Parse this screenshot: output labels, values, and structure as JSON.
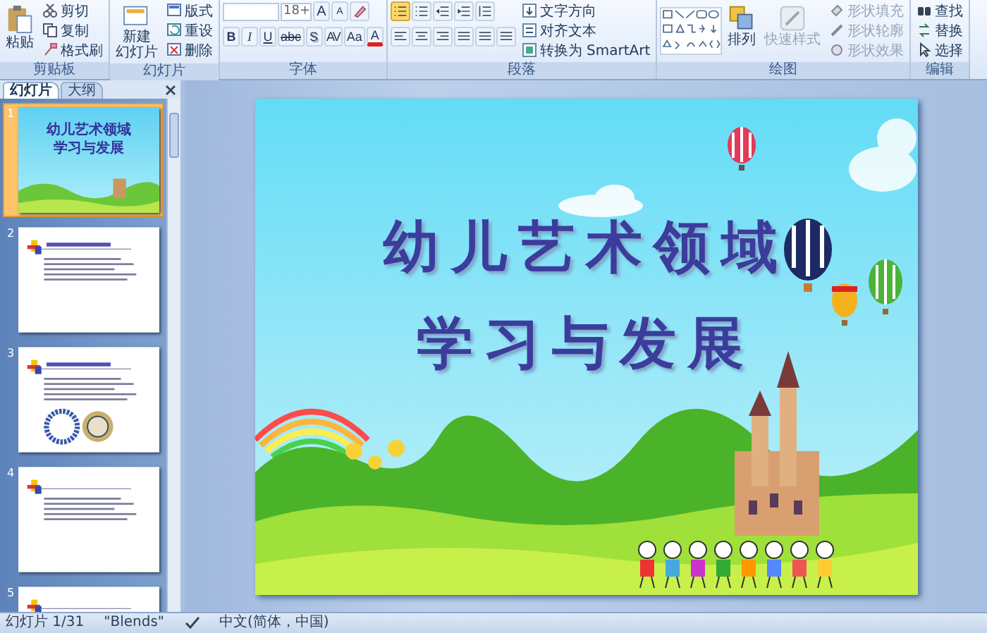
{
  "ribbon": {
    "clipboard": {
      "label": "剪贴板",
      "paste": "粘贴",
      "actions": [
        "剪切",
        "复制",
        "格式刷"
      ]
    },
    "slides": {
      "label": "幻灯片",
      "new_slide": [
        "新建",
        "幻灯片"
      ],
      "actions": [
        "版式",
        "重设",
        "删除"
      ]
    },
    "font": {
      "label": "字体",
      "font_size": "18+",
      "grow_shrink": [
        "A",
        "A"
      ],
      "format_buttons": [
        {
          "label": "B",
          "kind": "bold"
        },
        {
          "label": "I",
          "kind": "italic"
        },
        {
          "label": "U",
          "kind": "underline"
        },
        {
          "label": "abc",
          "kind": "strike"
        },
        {
          "label": "S",
          "kind": "shadow"
        },
        {
          "label": "AV",
          "kind": "spacing"
        },
        {
          "label": "Aa",
          "kind": "case"
        },
        {
          "label": "A",
          "kind": "color"
        }
      ]
    },
    "paragraph": {
      "label": "段落",
      "actions": [
        "文字方向",
        "对齐文本",
        "转换为 SmartArt"
      ]
    },
    "drawing": {
      "label": "绘图",
      "arrange": "排列",
      "quick_styles": {
        "label": "快速样式",
        "disabled": true
      },
      "shape_actions": [
        {
          "label": "形状填充",
          "disabled": true
        },
        {
          "label": "形状轮廓",
          "disabled": true
        },
        {
          "label": "形状效果",
          "disabled": true
        }
      ]
    },
    "editing": {
      "label": "编辑",
      "actions": [
        "查找",
        "替换",
        "选择"
      ]
    }
  },
  "pane": {
    "tabs": [
      {
        "label": "幻灯片",
        "selected": true
      },
      {
        "label": "大纲",
        "selected": false
      }
    ],
    "slides": [
      {
        "number": "1",
        "selected": true,
        "kind": "title",
        "title_lines": [
          "幼儿艺术领域",
          "学习与发展"
        ]
      },
      {
        "number": "2",
        "selected": false,
        "kind": "text"
      },
      {
        "number": "3",
        "selected": false,
        "kind": "images"
      },
      {
        "number": "4",
        "selected": false,
        "kind": "text"
      },
      {
        "number": "5",
        "selected": false,
        "kind": "text"
      }
    ]
  },
  "slide": {
    "title_lines": [
      "幼儿艺术领域",
      "学习与发展"
    ]
  },
  "status_bar": {
    "slide_counter": "幻灯片 1/31",
    "theme": "\"Blends\"",
    "language": "中文(简体，中国)"
  }
}
